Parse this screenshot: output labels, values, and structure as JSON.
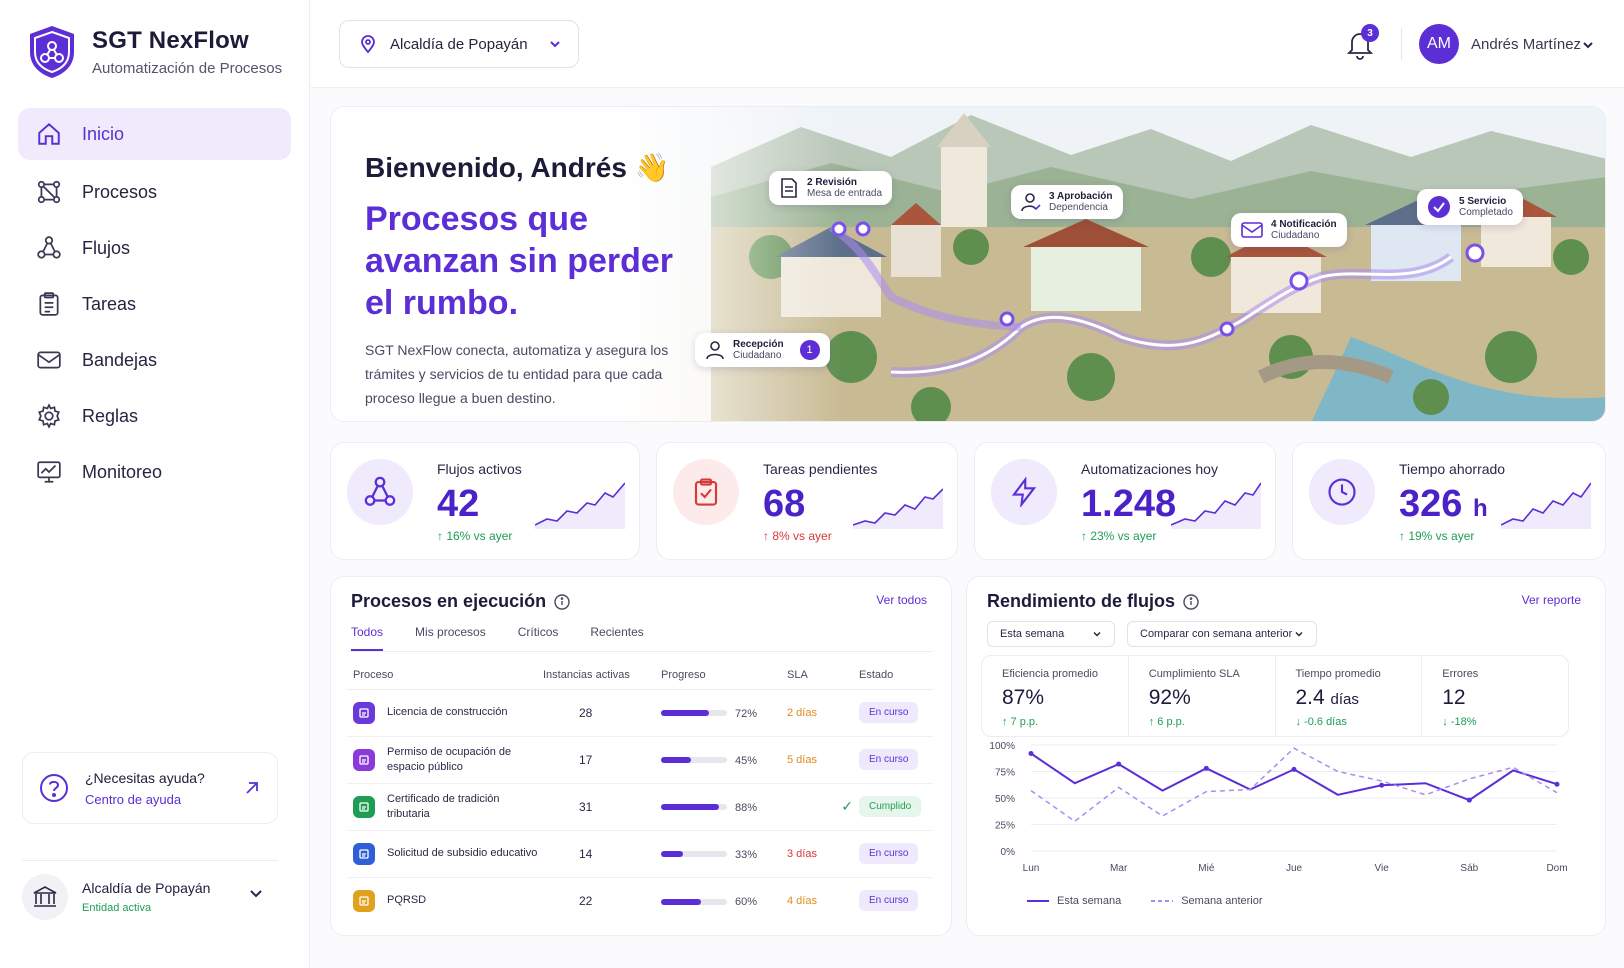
{
  "brand": {
    "title": "SGT NexFlow",
    "subtitle": "Automatización de Procesos"
  },
  "nav": [
    {
      "label": "Inicio",
      "icon": "home-icon"
    },
    {
      "label": "Procesos",
      "icon": "process-icon"
    },
    {
      "label": "Flujos",
      "icon": "flow-icon"
    },
    {
      "label": "Tareas",
      "icon": "clipboard-icon"
    },
    {
      "label": "Bandejas",
      "icon": "mail-icon"
    },
    {
      "label": "Reglas",
      "icon": "gear-icon"
    },
    {
      "label": "Monitoreo",
      "icon": "monitor-icon"
    }
  ],
  "help": {
    "title": "¿Necesitas ayuda?",
    "link": "Centro de ayuda"
  },
  "entity": {
    "name": "Alcaldía de Popayán",
    "status": "Entidad activa"
  },
  "topbar": {
    "location": "Alcaldía de Popayán",
    "notifications": "3",
    "avatar": "AM",
    "user": "Andrés Martínez"
  },
  "hero": {
    "greeting": "Bienvenido, Andrés",
    "wave": "👋",
    "headline": "Procesos que avanzan sin perder el rumbo.",
    "description": "SGT NexFlow conecta, automatiza y asegura los trámites y servicios de tu entidad para que cada proceso llegue a buen destino.",
    "steps": [
      {
        "title": "Recepción",
        "sub": "Ciudadano",
        "num": "1"
      },
      {
        "title": "2 Revisión",
        "sub": "Mesa de entrada"
      },
      {
        "title": "3 Aprobación",
        "sub": "Dependencia"
      },
      {
        "title": "4 Notificación",
        "sub": "Ciudadano"
      },
      {
        "title": "5 Servicio",
        "sub": "Completado"
      }
    ]
  },
  "stats": [
    {
      "label": "Flujos activos",
      "value": "42",
      "unit": "",
      "delta": "↑ 16% vs ayer",
      "trend": "up",
      "icon": "flow-icon"
    },
    {
      "label": "Tareas pendientes",
      "value": "68",
      "unit": "",
      "delta": "↑ 8% vs ayer",
      "trend": "up-bad",
      "icon": "clipboard-check-icon"
    },
    {
      "label": "Automatizaciones hoy",
      "value": "1.248",
      "unit": "",
      "delta": "↑ 23% vs ayer",
      "trend": "up",
      "icon": "lightning-icon"
    },
    {
      "label": "Tiempo ahorrado",
      "value": "326",
      "unit": "h",
      "delta": "↑ 19% vs ayer",
      "trend": "up",
      "icon": "clock-icon"
    }
  ],
  "processes": {
    "title": "Procesos en ejecución",
    "link": "Ver todos",
    "tabs": [
      "Todos",
      "Mis procesos",
      "Críticos",
      "Recientes"
    ],
    "columns": [
      "Proceso",
      "Instancias activas",
      "Progreso",
      "SLA",
      "Estado"
    ],
    "rows": [
      {
        "name": "Licencia de construcción",
        "instances": "28",
        "progress": 72,
        "progress_label": "72%",
        "sla": "2 días",
        "sla_color": "#e08a1e",
        "status": "En curso",
        "icon_color": "#6a3ad8",
        "icon_bg": "#ece6fb"
      },
      {
        "name": "Permiso de ocupación de espacio público",
        "instances": "17",
        "progress": 45,
        "progress_label": "45%",
        "sla": "5 días",
        "sla_color": "#e08a1e",
        "status": "En curso",
        "icon_color": "#8a3ad8",
        "icon_bg": "#f1e6fb"
      },
      {
        "name": "Certificado de tradición tributaria",
        "instances": "31",
        "progress": 88,
        "progress_label": "88%",
        "sla": "✓",
        "sla_color": "#1f9d55",
        "status": "Cumplido",
        "icon_color": "#1f9d55",
        "icon_bg": "#e3f5ea"
      },
      {
        "name": "Solicitud de subsidio educativo",
        "instances": "14",
        "progress": 33,
        "progress_label": "33%",
        "sla": "3 días",
        "sla_color": "#d63a3a",
        "status": "En curso",
        "icon_color": "#2f5fd6",
        "icon_bg": "#e6ecfb"
      },
      {
        "name": "PQRSD",
        "instances": "22",
        "progress": 60,
        "progress_label": "60%",
        "sla": "4 días",
        "sla_color": "#e08a1e",
        "status": "En curso",
        "icon_color": "#e0a21e",
        "icon_bg": "#fbf1dc"
      }
    ]
  },
  "performance": {
    "title": "Rendimiento de flujos",
    "link": "Ver reporte",
    "period": "Esta semana",
    "compare": "Comparar con semana anterior",
    "kpis": [
      {
        "label": "Eficiencia promedio",
        "value": "87%",
        "unit": "",
        "delta": "↑ 7 p.p.",
        "color": "#1f9d55"
      },
      {
        "label": "Cumplimiento SLA",
        "value": "92%",
        "unit": "",
        "delta": "↑ 6 p.p.",
        "color": "#1f9d55"
      },
      {
        "label": "Tiempo promedio",
        "value": "2.4",
        "unit": "días",
        "delta": "↓ -0.6 días",
        "color": "#1f9d55"
      },
      {
        "label": "Errores",
        "value": "12",
        "unit": "",
        "delta": "↓ -18%",
        "color": "#1f9d55"
      }
    ]
  },
  "chart_data": {
    "type": "line",
    "categories": [
      "Lun",
      "Mar",
      "Mié",
      "Jue",
      "Vie",
      "Sáb",
      "Dom"
    ],
    "x": [
      "Lun",
      "",
      "Mar",
      "",
      "Mié",
      "",
      "Jue",
      "",
      "Vie",
      "",
      "Sáb",
      "",
      "Dom"
    ],
    "yticks": [
      "100%",
      "75%",
      "50%",
      "25%",
      "0%"
    ],
    "ylim": [
      0,
      100
    ],
    "series": [
      {
        "name": "Esta semana",
        "style": "solid",
        "color": "#5b2ed6",
        "values": [
          92,
          64,
          82,
          57,
          78,
          58,
          77,
          53,
          62,
          64,
          48,
          76,
          63
        ]
      },
      {
        "name": "Semana anterior",
        "style": "dashed",
        "color": "#a98cf0",
        "values": [
          57,
          28,
          60,
          33,
          56,
          58,
          97,
          75,
          66,
          53,
          68,
          79,
          55
        ]
      }
    ],
    "legend": "bottom-left"
  },
  "colors": {
    "accent": "#5b2ed6",
    "positive": "#1f9d55",
    "negative": "#d63a3a",
    "warning": "#e08a1e"
  }
}
